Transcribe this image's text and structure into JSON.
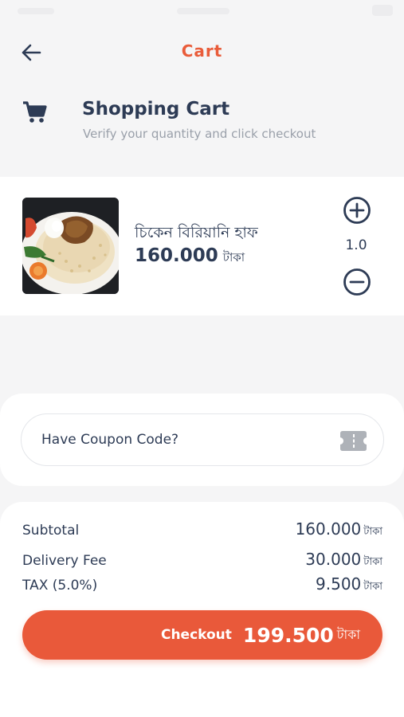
{
  "app_bar": {
    "title": "Cart",
    "back_icon": "arrow-left-icon"
  },
  "header": {
    "icon": "shopping-cart-icon",
    "title": "Shopping Cart",
    "subtitle": "Verify your quantity and click checkout"
  },
  "cart": {
    "items": [
      {
        "name": "চিকেন বিরিয়ানি হাফ",
        "price": "160.000",
        "currency": "টাকা",
        "quantity": "1.0",
        "image": "chicken-biryani-photo"
      }
    ]
  },
  "coupon": {
    "label": "Have Coupon Code?",
    "icon": "coupon-ticket-icon"
  },
  "summary": {
    "subtotal_label": "Subtotal",
    "subtotal_value": "160.000",
    "delivery_label": "Delivery Fee",
    "delivery_value": "30.000",
    "tax_label": "TAX (5.0%)",
    "tax_value": "9.500",
    "currency": "টাকা"
  },
  "checkout": {
    "label": "Checkout",
    "total": "199.500",
    "currency": "টাকা"
  },
  "colors": {
    "accent": "#e9593a",
    "text_dark": "#2d3b55",
    "text_muted": "#9aa0aa",
    "background": "#f5f5f6"
  }
}
